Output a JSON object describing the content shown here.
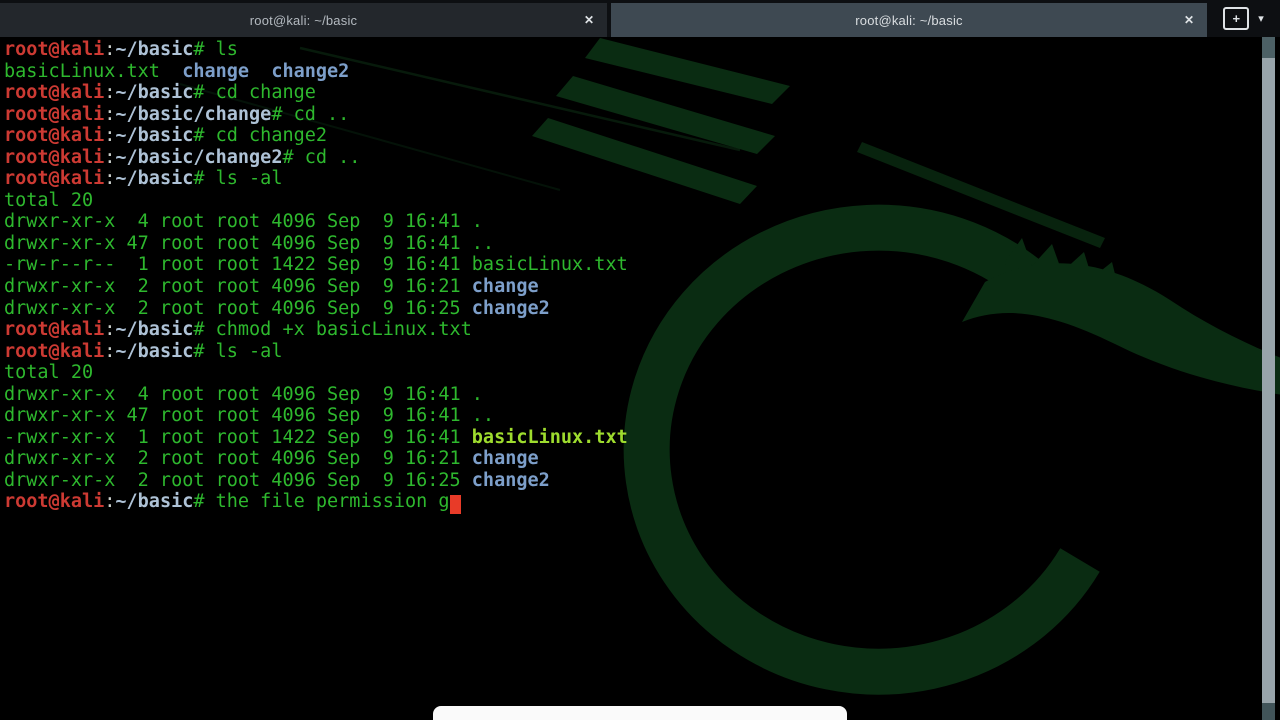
{
  "colors": {
    "tabbar_bg": "#0d0f12",
    "tab_inactive_bg": "#23272c",
    "tab_active_bg": "#3e4952",
    "tab_text_inactive": "#b4bac0",
    "tab_text_active": "#d9dde0",
    "icon": "#dfe3e6",
    "term_bg": "#000000",
    "green": "#2eb82e",
    "red": "#cd3a33",
    "punct": "#ccd1cd",
    "pathblue": "#aec2d6",
    "dirblue": "#7d9fca",
    "execgreen": "#9edc2e",
    "cursor": "#e83b28",
    "scroll_track": "#98a4aa",
    "scroll_step_top": "#4c6065",
    "scroll_step_bottom": "#415459",
    "watermark": "#0a2c12",
    "pill": "#fafafa"
  },
  "window": {
    "tabs": [
      {
        "title": "root@kali: ~/basic",
        "close_glyph": "✕"
      },
      {
        "title": "root@kali: ~/basic",
        "close_glyph": "✕"
      }
    ],
    "controls": {
      "new_tab_glyph": "+",
      "menu_glyph": "▾"
    }
  },
  "terminal": {
    "lines": [
      {
        "seg": [
          [
            "user",
            "root@kali"
          ],
          [
            "punct",
            ":"
          ],
          [
            "path",
            "~/basic"
          ],
          [
            "cmd",
            "# ls"
          ]
        ]
      },
      {
        "seg": [
          [
            "cmd",
            "basicLinux.txt  "
          ],
          [
            "dir",
            "change"
          ],
          [
            "cmd",
            "  "
          ],
          [
            "dir",
            "change2"
          ]
        ]
      },
      {
        "seg": [
          [
            "user",
            "root@kali"
          ],
          [
            "punct",
            ":"
          ],
          [
            "path",
            "~/basic"
          ],
          [
            "cmd",
            "# cd change"
          ]
        ]
      },
      {
        "seg": [
          [
            "user",
            "root@kali"
          ],
          [
            "punct",
            ":"
          ],
          [
            "path",
            "~/basic/change"
          ],
          [
            "cmd",
            "# cd .."
          ]
        ]
      },
      {
        "seg": [
          [
            "user",
            "root@kali"
          ],
          [
            "punct",
            ":"
          ],
          [
            "path",
            "~/basic"
          ],
          [
            "cmd",
            "# cd change2"
          ]
        ]
      },
      {
        "seg": [
          [
            "user",
            "root@kali"
          ],
          [
            "punct",
            ":"
          ],
          [
            "path",
            "~/basic/change2"
          ],
          [
            "cmd",
            "# cd .."
          ]
        ]
      },
      {
        "seg": [
          [
            "user",
            "root@kali"
          ],
          [
            "punct",
            ":"
          ],
          [
            "path",
            "~/basic"
          ],
          [
            "cmd",
            "# ls -al"
          ]
        ]
      },
      {
        "seg": [
          [
            "cmd",
            "total 20"
          ]
        ]
      },
      {
        "seg": [
          [
            "cmd",
            "drwxr-xr-x  4 root root 4096 Sep  9 16:41 ."
          ]
        ]
      },
      {
        "seg": [
          [
            "cmd",
            "drwxr-xr-x 47 root root 4096 Sep  9 16:41 .."
          ]
        ]
      },
      {
        "seg": [
          [
            "cmd",
            "-rw-r--r--  1 root root 1422 Sep  9 16:41 basicLinux.txt"
          ]
        ]
      },
      {
        "seg": [
          [
            "cmd",
            "drwxr-xr-x  2 root root 4096 Sep  9 16:21 "
          ],
          [
            "dir",
            "change"
          ]
        ]
      },
      {
        "seg": [
          [
            "cmd",
            "drwxr-xr-x  2 root root 4096 Sep  9 16:25 "
          ],
          [
            "dir",
            "change2"
          ]
        ]
      },
      {
        "seg": [
          [
            "user",
            "root@kali"
          ],
          [
            "punct",
            ":"
          ],
          [
            "path",
            "~/basic"
          ],
          [
            "cmd",
            "# chmod +x basicLinux.txt"
          ]
        ]
      },
      {
        "seg": [
          [
            "user",
            "root@kali"
          ],
          [
            "punct",
            ":"
          ],
          [
            "path",
            "~/basic"
          ],
          [
            "cmd",
            "# ls -al"
          ]
        ]
      },
      {
        "seg": [
          [
            "cmd",
            "total 20"
          ]
        ]
      },
      {
        "seg": [
          [
            "cmd",
            "drwxr-xr-x  4 root root 4096 Sep  9 16:41 ."
          ]
        ]
      },
      {
        "seg": [
          [
            "cmd",
            "drwxr-xr-x 47 root root 4096 Sep  9 16:41 .."
          ]
        ]
      },
      {
        "seg": [
          [
            "cmd",
            "-rwxr-xr-x  1 root root 1422 Sep  9 16:41 "
          ],
          [
            "exec",
            "basicLinux.txt"
          ]
        ]
      },
      {
        "seg": [
          [
            "cmd",
            "drwxr-xr-x  2 root root 4096 Sep  9 16:21 "
          ],
          [
            "dir",
            "change"
          ]
        ]
      },
      {
        "seg": [
          [
            "cmd",
            "drwxr-xr-x  2 root root 4096 Sep  9 16:25 "
          ],
          [
            "dir",
            "change2"
          ]
        ]
      },
      {
        "seg": [
          [
            "user",
            "root@kali"
          ],
          [
            "punct",
            ":"
          ],
          [
            "path",
            "~/basic"
          ],
          [
            "cmd",
            "# the file permission g"
          ]
        ],
        "cursor": true
      }
    ]
  }
}
